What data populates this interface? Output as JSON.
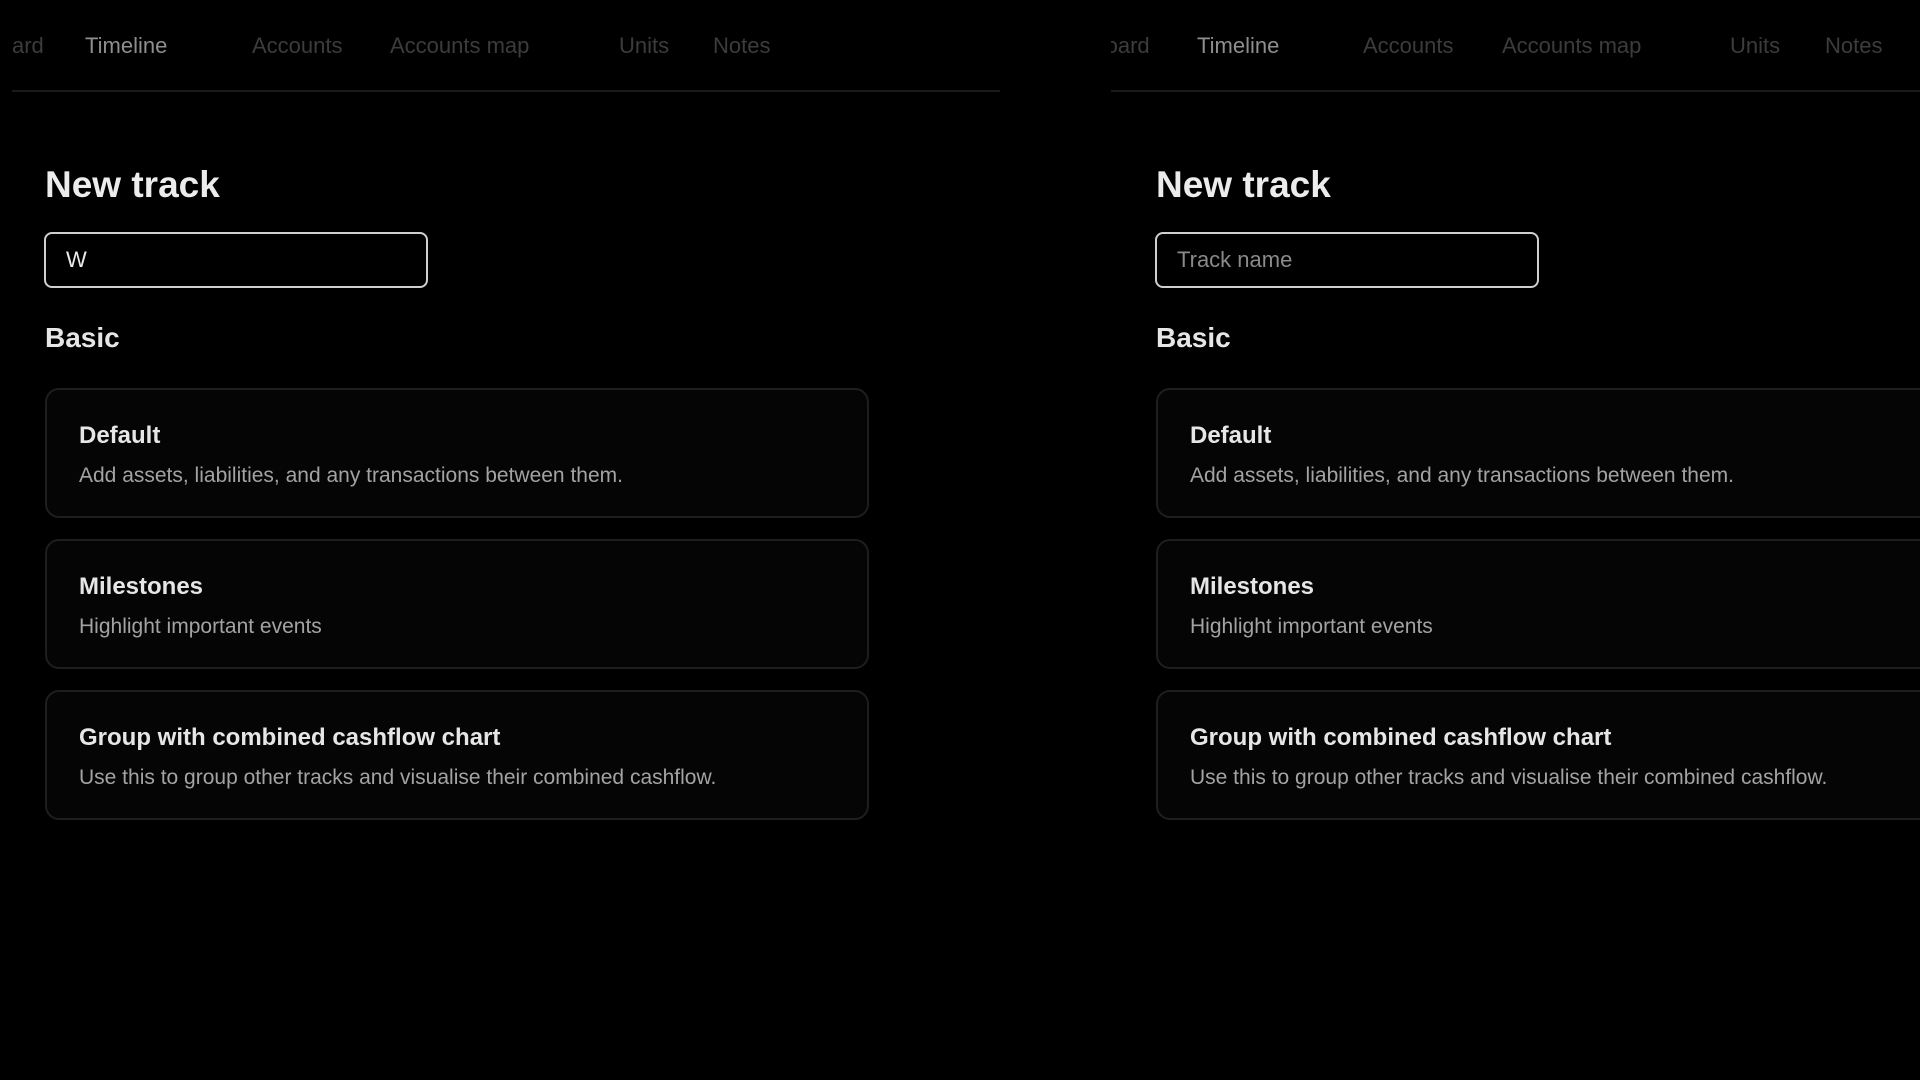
{
  "left_pane": {
    "nav": {
      "items": [
        {
          "label": "ard",
          "active": false
        },
        {
          "label": "Timeline",
          "active": true
        },
        {
          "label": "Accounts",
          "active": false
        },
        {
          "label": "Accounts map",
          "active": false
        },
        {
          "label": "Units",
          "active": false
        },
        {
          "label": "Notes",
          "active": false
        }
      ]
    },
    "title": "New track",
    "input": {
      "value": "W",
      "placeholder": "Track name"
    },
    "section_heading": "Basic",
    "cards": [
      {
        "title": "Default",
        "description": "Add assets, liabilities, and any transactions between them."
      },
      {
        "title": "Milestones",
        "description": "Highlight important events"
      },
      {
        "title": "Group with combined cashflow chart",
        "description": "Use this to group other tracks and visualise their combined cashflow."
      }
    ]
  },
  "right_pane": {
    "nav": {
      "items": [
        {
          "label": "Dashboard",
          "active": false
        },
        {
          "label": "Timeline",
          "active": true
        },
        {
          "label": "Accounts",
          "active": false
        },
        {
          "label": "Accounts map",
          "active": false
        },
        {
          "label": "Units",
          "active": false
        },
        {
          "label": "Notes",
          "active": false
        }
      ]
    },
    "title": "New track",
    "input": {
      "value": "",
      "placeholder": "Track name"
    },
    "section_heading": "Basic",
    "cards": [
      {
        "title": "Default",
        "description": "Add assets, liabilities, and any transactions between them."
      },
      {
        "title": "Milestones",
        "description": "Highlight important events"
      },
      {
        "title": "Group with combined cashflow chart",
        "description": "Use this to group other tracks and visualise their combined cashflow."
      }
    ]
  },
  "colors": {
    "background": "#000000",
    "nav_inactive": "#3c3c3c",
    "nav_active": "#8e8e8e",
    "title_text": "#ececec",
    "card_border": "#1e1e1e",
    "card_description": "#a3a3a3",
    "input_border": "#cfcfcf"
  }
}
